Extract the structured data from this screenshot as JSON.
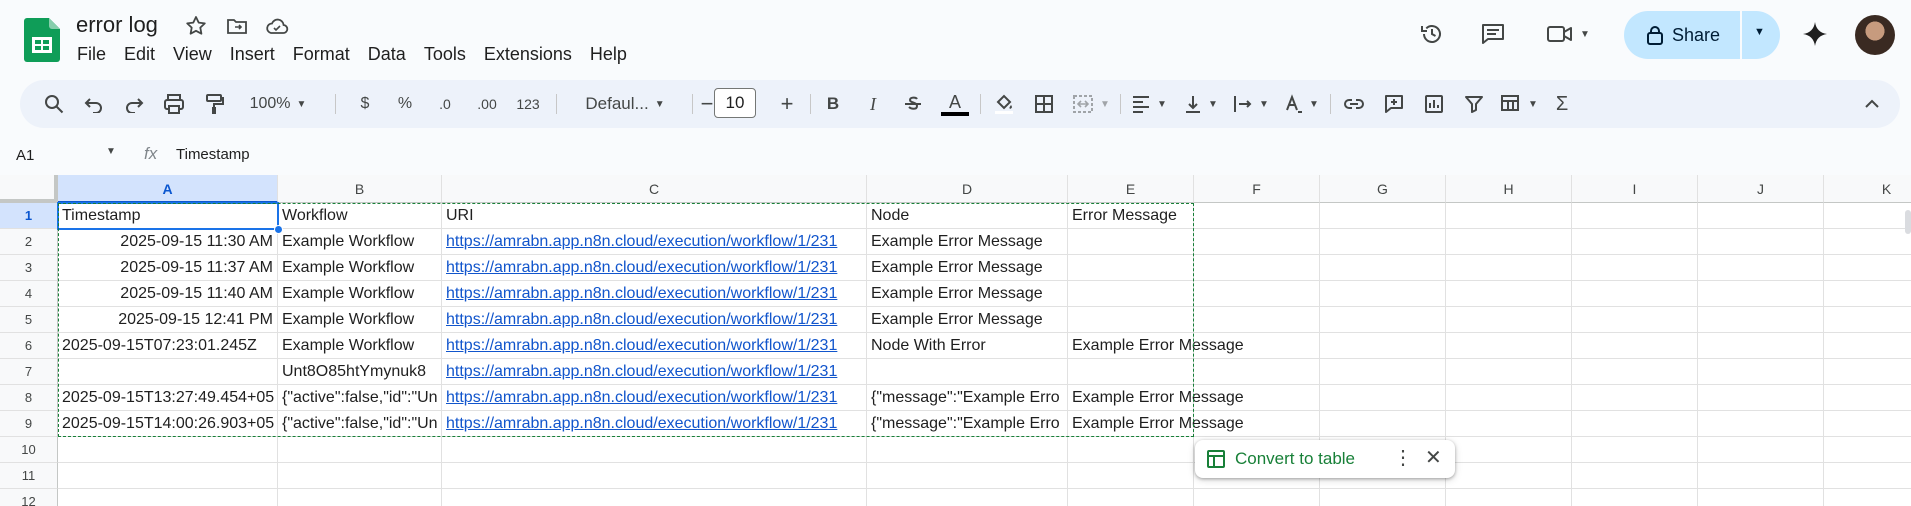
{
  "app": {
    "title": "error log"
  },
  "menu": [
    "File",
    "Edit",
    "View",
    "Insert",
    "Format",
    "Data",
    "Tools",
    "Extensions",
    "Help"
  ],
  "header": {
    "share_label": "Share"
  },
  "toolbar": {
    "zoom": "100%",
    "currency": "$",
    "percent": "%",
    "decimal_decrease": ".0",
    "decimal_increase": ".00",
    "number_format": "123",
    "font": "Defaul...",
    "font_size": "10",
    "bold": "B",
    "italic": "I",
    "text_color": "A"
  },
  "formula_bar": {
    "cell_ref": "A1",
    "fx": "fx",
    "value": "Timestamp"
  },
  "columns": [
    "A",
    "B",
    "C",
    "D",
    "E",
    "F",
    "G",
    "H",
    "I",
    "J",
    "K"
  ],
  "rows": [
    "1",
    "2",
    "3",
    "4",
    "5",
    "6",
    "7",
    "8",
    "9",
    "10",
    "11",
    "12"
  ],
  "cells": [
    [
      "Timestamp",
      "Workflow",
      "URI",
      "Node",
      "Error Message"
    ],
    [
      "2025-09-15 11:30 AM",
      "Example Workflow",
      "https://amrabn.app.n8n.cloud/execution/workflow/1/231",
      "Example Error Message",
      ""
    ],
    [
      "2025-09-15 11:37 AM",
      "Example Workflow",
      "https://amrabn.app.n8n.cloud/execution/workflow/1/231",
      "Example Error Message",
      ""
    ],
    [
      "2025-09-15 11:40 AM",
      "Example Workflow",
      "https://amrabn.app.n8n.cloud/execution/workflow/1/231",
      "Example Error Message",
      ""
    ],
    [
      "2025-09-15 12:41 PM",
      "Example Workflow",
      "https://amrabn.app.n8n.cloud/execution/workflow/1/231",
      "Example Error Message",
      ""
    ],
    [
      "2025-09-15T07:23:01.245Z",
      "Example Workflow",
      "https://amrabn.app.n8n.cloud/execution/workflow/1/231",
      "Node With Error",
      "Example Error Message"
    ],
    [
      "",
      "Unt8O85htYmynuk8",
      "https://amrabn.app.n8n.cloud/execution/workflow/1/231",
      "",
      ""
    ],
    [
      "2025-09-15T13:27:49.454+05",
      "{\"active\":false,\"id\":\"Un",
      "https://amrabn.app.n8n.cloud/execution/workflow/1/231",
      "{\"message\":\"Example Erro",
      "Example Error Message"
    ],
    [
      "2025-09-15T14:00:26.903+05",
      "{\"active\":false,\"id\":\"Un",
      "https://amrabn.app.n8n.cloud/execution/workflow/1/231",
      "{\"message\":\"Example Erro",
      "Example Error Message"
    ]
  ],
  "convert_popup": {
    "label": "Convert to table"
  }
}
